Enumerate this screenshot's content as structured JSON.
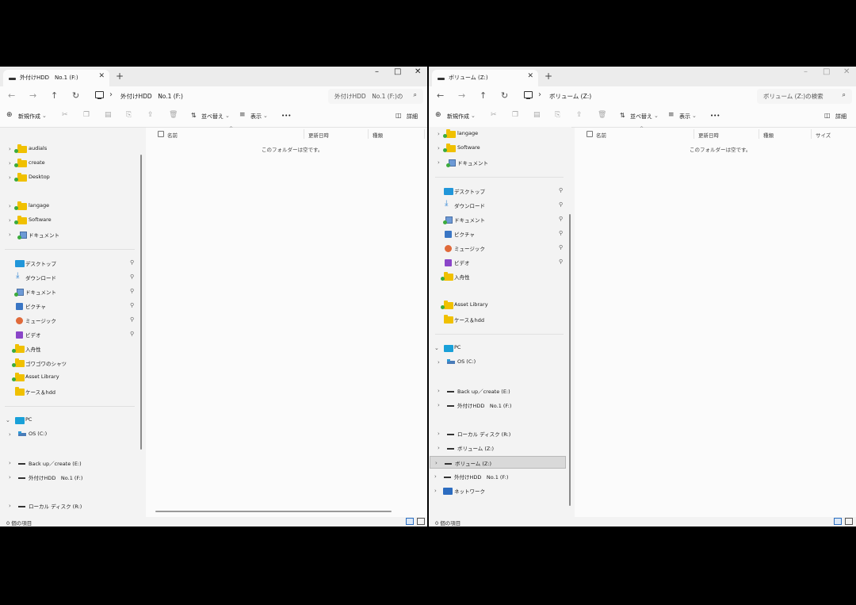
{
  "left": {
    "tab_title": "外付けHDD　No.1 (F:)",
    "address": "外付けHDD　No.1 (F:)",
    "search_placeholder": "外付けHDD　No.1 (F:)の",
    "sidebar": {
      "group1": [
        "audials",
        "create",
        "Desktop"
      ],
      "group2": [
        "langage",
        "Software",
        "ドキュメント"
      ],
      "quick": [
        {
          "label": "デスクトップ",
          "icon": "desktop-icon",
          "pinned": true
        },
        {
          "label": "ダウンロード",
          "icon": "download-icon",
          "pinned": true
        },
        {
          "label": "ドキュメント",
          "icon": "document-icon",
          "pinned": true
        },
        {
          "label": "ピクチャ",
          "icon": "pictures-icon",
          "pinned": true
        },
        {
          "label": "ミュージック",
          "icon": "music-icon",
          "pinned": true
        },
        {
          "label": "ビデオ",
          "icon": "video-icon",
          "pinned": true
        }
      ],
      "folders": [
        "入舟性",
        "ゴワゴワのシャツ",
        "Asset Library",
        "ケース＆hdd"
      ],
      "pc": "PC",
      "drives": [
        "OS (C:)",
        "Back up／create (E:)",
        "外付けHDD　No.1 (F:)",
        "ローカル ディスク (R:)"
      ]
    },
    "columns": [
      "名前",
      "更新日時",
      "種類"
    ],
    "empty_message": "このフォルダーは空です。",
    "status": "0 個の項目"
  },
  "right": {
    "tab_title": "ボリューム (Z:)",
    "address": "ボリューム (Z:)",
    "search_placeholder": "ボリューム (Z:)の検索",
    "sidebar": {
      "group1": [
        "langage",
        "Software",
        "ドキュメント"
      ],
      "quick": [
        {
          "label": "デスクトップ",
          "icon": "desktop-icon",
          "pinned": true
        },
        {
          "label": "ダウンロード",
          "icon": "download-icon",
          "pinned": true
        },
        {
          "label": "ドキュメント",
          "icon": "document-icon",
          "pinned": true
        },
        {
          "label": "ピクチャ",
          "icon": "pictures-icon",
          "pinned": true
        },
        {
          "label": "ミュージック",
          "icon": "music-icon",
          "pinned": true
        },
        {
          "label": "ビデオ",
          "icon": "video-icon",
          "pinned": true
        }
      ],
      "folders": [
        "入舟性",
        "Asset Library",
        "ケース＆hdd"
      ],
      "pc": "PC",
      "drives": [
        "OS (C:)",
        "Back up／create (E:)",
        "外付けHDD　No.1 (F:)",
        "ローカル ディスク (R:)",
        "ボリューム (Z:)",
        "ボリューム (Z:)",
        "外付けHDD　No.1 (F:)"
      ],
      "network": "ネットワーク",
      "selected_drive": "ボリューム (Z:)"
    },
    "columns": [
      "名前",
      "更新日時",
      "種類",
      "サイズ"
    ],
    "empty_message": "このフォルダーは空です。",
    "status": "0 個の項目"
  },
  "toolbar": {
    "new_label": "新規作成",
    "sort_label": "並べ替え",
    "view_label": "表示",
    "more_label": "•••",
    "details_label": "詳細"
  },
  "window_controls": {
    "minimize": "–",
    "maximize": "□",
    "close": "✕"
  },
  "nav": {
    "back": "←",
    "forward": "→",
    "up": "↑",
    "refresh": "↻"
  },
  "colors": {
    "folder": "#f0c000",
    "accent": "#2d6fc2",
    "selection": "#d9d9d9",
    "window_bg": "#f3f3f3"
  }
}
